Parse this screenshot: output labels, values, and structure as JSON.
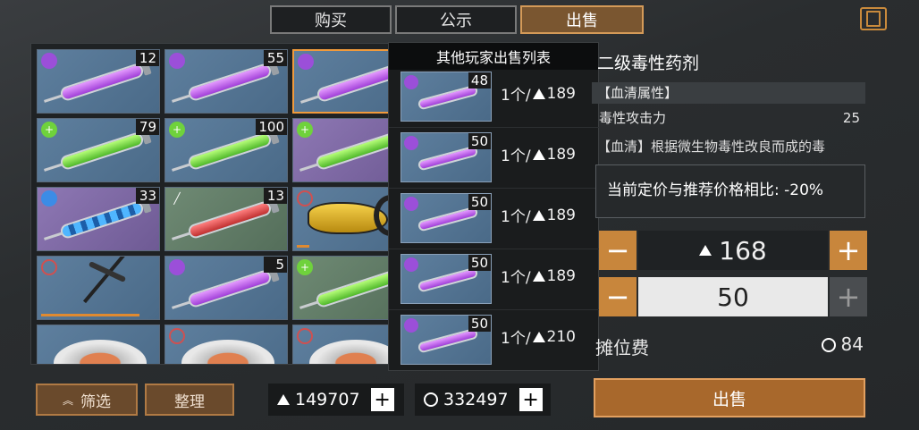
{
  "tabs": [
    {
      "label": "购买",
      "active": false
    },
    {
      "label": "公示",
      "active": false
    },
    {
      "label": "出售",
      "active": true
    }
  ],
  "inventory": {
    "cells": [
      {
        "color": "blue",
        "tag": "skull",
        "item": "purple-serum",
        "count": "12"
      },
      {
        "color": "blue",
        "tag": "skull",
        "item": "purple-serum",
        "count": "55"
      },
      {
        "color": "blue",
        "tag": "skull",
        "item": "purple-serum",
        "count": "",
        "selected": true
      },
      {
        "color": "blue",
        "tag": "heart",
        "item": "green-serum",
        "count": "79"
      },
      {
        "color": "blue",
        "tag": "heart",
        "item": "green-serum",
        "count": "100"
      },
      {
        "color": "purple",
        "tag": "heart",
        "item": "green-serum-large",
        "count": ""
      },
      {
        "color": "purple",
        "tag": "shield",
        "item": "blue-serum",
        "count": "33"
      },
      {
        "color": "green",
        "tag": "drop",
        "item": "red-serum",
        "count": "13"
      },
      {
        "color": "blue",
        "tag": "ban",
        "item": "drone",
        "count": ""
      },
      {
        "color": "blue",
        "tag": "ban",
        "item": "pickaxe",
        "count": ""
      },
      {
        "color": "blue",
        "tag": "skull",
        "item": "purple-serum",
        "count": "5"
      },
      {
        "color": "green",
        "tag": "heart",
        "item": "green-serum",
        "count": ""
      },
      {
        "color": "blue",
        "tag": "",
        "item": "food-plate",
        "count": ""
      },
      {
        "color": "blue",
        "tag": "ban",
        "item": "fish-plate",
        "count": ""
      },
      {
        "color": "blue",
        "tag": "ban",
        "item": "candy-plate",
        "count": ""
      }
    ]
  },
  "popup": {
    "title": "其他玩家出售列表",
    "listings": [
      {
        "count": "48",
        "price": "1个/",
        "amount": "189"
      },
      {
        "count": "50",
        "price": "1个/",
        "amount": "189"
      },
      {
        "count": "50",
        "price": "1个/",
        "amount": "189"
      },
      {
        "count": "50",
        "price": "1个/",
        "amount": "189"
      },
      {
        "count": "50",
        "price": "1个/",
        "amount": "210"
      }
    ]
  },
  "detail": {
    "name": "二级毒性药剂",
    "attr_header": "【血清属性】",
    "attr_label": "毒性攻击力",
    "attr_value": "25",
    "desc": "【血清】根据微生物毒性改良而成的毒",
    "compare": "当前定价与推荐价格相比: -20%",
    "price": "168",
    "quantity": "50",
    "fee_label": "摊位费",
    "fee_value": "84",
    "sell_label": "出售"
  },
  "bottom": {
    "filter_label": "筛选",
    "sort_label": "整理",
    "gold_amount": "149707",
    "coin_amount": "332497"
  }
}
